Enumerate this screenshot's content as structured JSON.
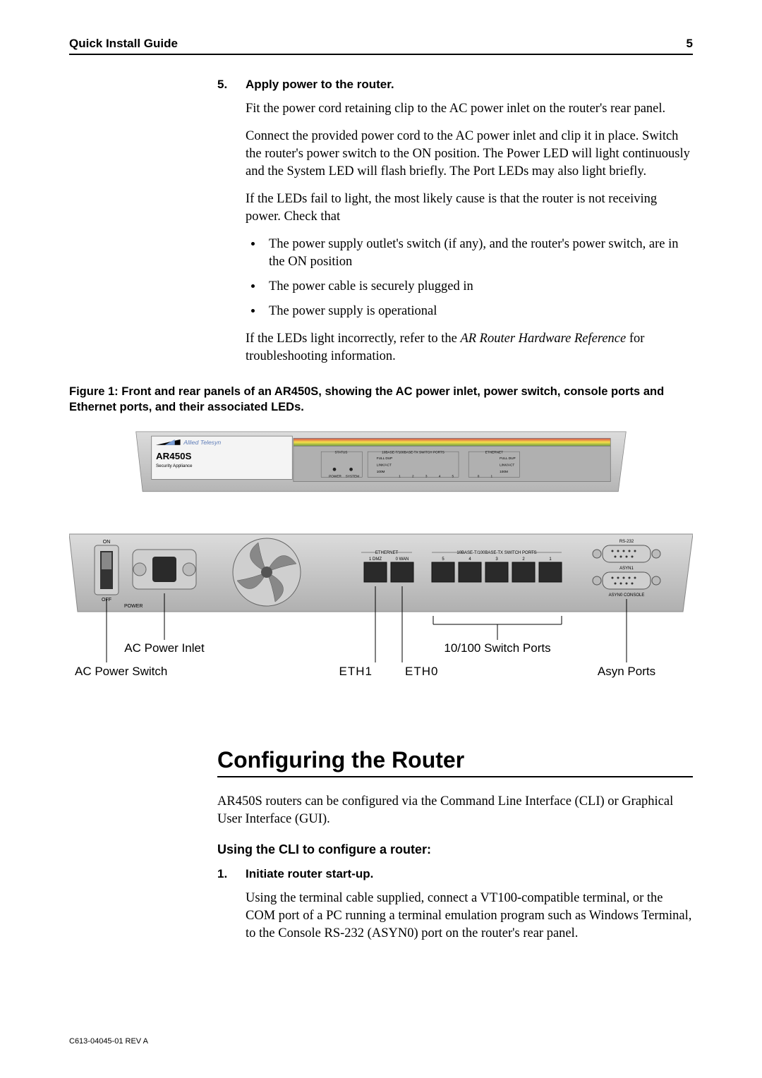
{
  "header": {
    "left": "Quick Install Guide",
    "right": "5"
  },
  "step5": {
    "num": "5.",
    "title": "Apply power to the router.",
    "p1": "Fit the power cord retaining clip to the AC power inlet on the router's rear panel.",
    "p2": "Connect the provided power cord to the AC power inlet and clip it in place. Switch the router's power switch to the ON position. The Power LED will light continuously and the System LED will flash briefly. The Port LEDs may also light briefly.",
    "p3": "If the LEDs fail to light, the most likely cause is that the router is not receiving power. Check that",
    "bullets": [
      "The power supply outlet's switch (if any), and the router's power switch, are in the ON position",
      "The power cable is securely plugged in",
      "The power supply is operational"
    ],
    "p4a": "If the LEDs light incorrectly, refer to the ",
    "p4_ref": "AR Router Hardware Reference",
    "p4b": " for troubleshooting information."
  },
  "figure_caption": "Figure 1: Front and rear panels of an AR450S, showing the AC power inlet, power switch, console ports and Ethernet ports, and their associated LEDs.",
  "front_panel": {
    "brand": "Allied Telesyn",
    "model": "AR450S",
    "subtitle": "Security Appliance",
    "status_label": "STATUS",
    "switch_label": "10BASE-T/100BASE-TX SWITCH PORTS",
    "eth_label": "ETHERNET",
    "line1": "FULL DUP",
    "line2": "LINK/ACT",
    "line3": "100M",
    "power": "POWER",
    "system": "SYSTEM",
    "switch_nums": [
      "1",
      "2",
      "3",
      "4",
      "5"
    ],
    "eth_nums": [
      "0",
      "1"
    ]
  },
  "rear_panel": {
    "on": "ON",
    "off": "OFF",
    "power": "POWER",
    "eth_label": "ETHERNET",
    "eth1": "1 DMZ",
    "eth0": "0 WAN",
    "switch_label": "10BASE-T/100BASE-TX SWITCH PORTS",
    "switch_nums": [
      "5",
      "4",
      "3",
      "2",
      "1"
    ],
    "rs232": "RS-232",
    "asyn1": "ASYN1",
    "asyn0": "ASYN0 CONSOLE"
  },
  "callouts": {
    "ac_inlet": "AC Power Inlet",
    "ac_switch": "AC Power Switch",
    "eth1": "ETH1",
    "eth0": "ETH0",
    "switch_ports": "10/100 Switch Ports",
    "asyn_ports": "Asyn Ports"
  },
  "section2": {
    "title": "Configuring the Router",
    "intro": "AR450S routers can be configured via the Command Line Interface (CLI) or Graphical User Interface (GUI).",
    "sub": "Using the CLI to configure a router:",
    "step1_num": "1.",
    "step1_title": "Initiate router start-up.",
    "step1_body": "Using the terminal cable supplied, connect a VT100-compatible terminal, or the COM port of a PC running a terminal emulation program such as Windows Terminal, to the Console RS-232 (ASYN0) port on the router's rear panel."
  },
  "footer": "C613-04045-01 REV A"
}
